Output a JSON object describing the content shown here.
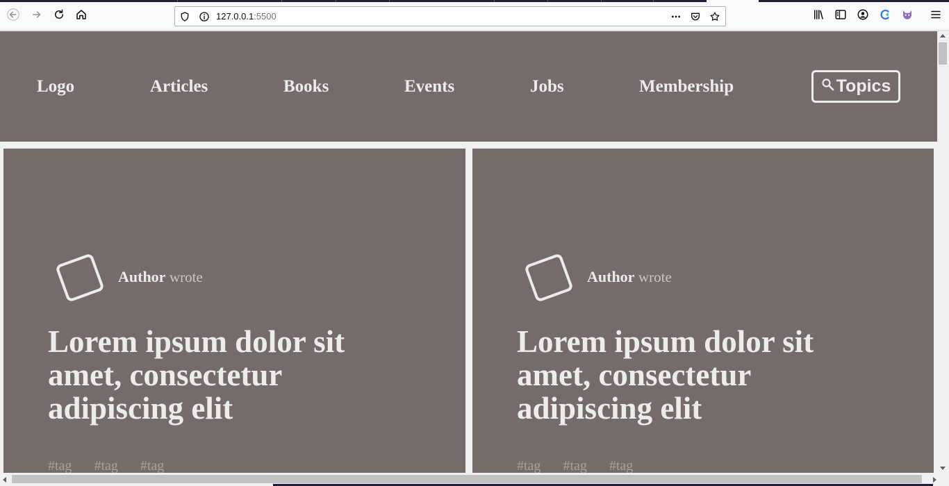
{
  "browser": {
    "url_host": "127.0.0.1",
    "url_port": ":5500",
    "icons": [
      "back-arrow-icon",
      "forward-arrow-icon",
      "reload-icon",
      "home-icon",
      "shield-icon",
      "info-icon",
      "more-dots-icon",
      "pocket-icon",
      "bookmark-star-icon",
      "library-icon",
      "sidebar-icon",
      "account-icon",
      "extension-icon",
      "extension-fox-icon",
      "menu-icon"
    ]
  },
  "nav": {
    "items": [
      {
        "label": "Logo"
      },
      {
        "label": "Articles"
      },
      {
        "label": "Books"
      },
      {
        "label": "Events"
      },
      {
        "label": "Jobs"
      },
      {
        "label": "Membership"
      }
    ],
    "topics_label": "Topics"
  },
  "cards": [
    {
      "author": "Author",
      "author_suffix": "wrote",
      "title": "Lorem ipsum dolor sit amet, consectetur adipiscing elit",
      "tags": [
        "#tag",
        "#tag",
        "#tag"
      ]
    },
    {
      "author": "Author",
      "author_suffix": "wrote",
      "title": "Lorem ipsum dolor sit amet, consectetur adipiscing elit",
      "tags": [
        "#tag",
        "#tag",
        "#tag"
      ]
    }
  ],
  "colors": {
    "page_surface": "#756c69",
    "page_text": "#ececec",
    "tag_text": "#a8a09d",
    "page_background": "#f0f0f0"
  }
}
